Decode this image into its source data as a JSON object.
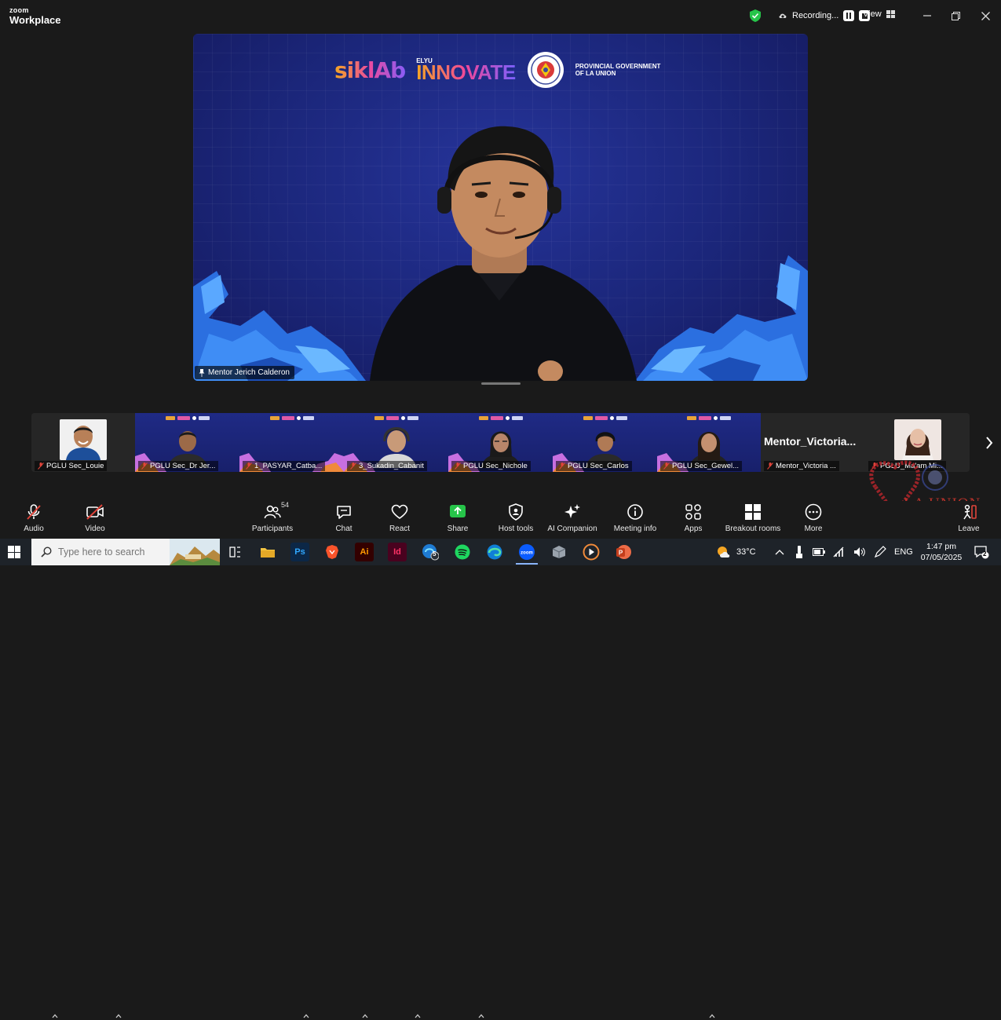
{
  "window": {
    "brand_top": "zoom",
    "brand_bottom": "Workplace",
    "recording_label": "Recording...",
    "view_label": "View",
    "controls": [
      "minimize",
      "restore",
      "close"
    ]
  },
  "main_video": {
    "speaker_name": "Mentor Jerich Calderon",
    "background_logos": {
      "siklab": "siklAb",
      "elyu_top": "ELYU",
      "elyu_main": "INNOVATE",
      "gov_line1": "PROVINCIAL GOVERNMENT",
      "gov_line2": "OF LA UNION"
    }
  },
  "participants": [
    {
      "label": "PGLU Sec_Louie",
      "kind": "photo"
    },
    {
      "label": "PGLU Sec_Dr Jer...",
      "kind": "video"
    },
    {
      "label": "1_PASYAR_Catba...",
      "kind": "video"
    },
    {
      "label": "3_Sukadin_Cabanit",
      "kind": "video"
    },
    {
      "label": "PGLU Sec_Nichole",
      "kind": "video"
    },
    {
      "label": "PGLU Sec_Carlos",
      "kind": "video"
    },
    {
      "label": "PGLU Sec_Gewel...",
      "kind": "video"
    },
    {
      "label": "Mentor_Victoria ...",
      "kind": "name",
      "big_name": "Mentor_Victoria..."
    },
    {
      "label": "PGLU_Ma'am Mi...",
      "kind": "photo"
    }
  ],
  "toolbar": {
    "audio": "Audio",
    "video": "Video",
    "participants": "Participants",
    "participants_count": "54",
    "chat": "Chat",
    "react": "React",
    "share": "Share",
    "host_tools": "Host tools",
    "ai_companion": "AI Companion",
    "meeting_info": "Meeting info",
    "apps": "Apps",
    "breakout_rooms": "Breakout rooms",
    "more": "More",
    "leave": "Leave"
  },
  "watermark": {
    "text": "LA UNION"
  },
  "taskbar": {
    "search_placeholder": "Type here to search",
    "apps": [
      "task-view",
      "file-explorer",
      "photoshop",
      "brave",
      "illustrator",
      "indesign",
      "edge-badge",
      "spotify",
      "edge",
      "zoom",
      "app-box",
      "media-player",
      "powerpoint"
    ],
    "ps": "Ps",
    "ai": "Ai",
    "id": "Id",
    "badge_count": "5",
    "temperature": "33°C",
    "language": "ENG",
    "time": "1:47 pm",
    "date": "07/05/2025",
    "notification_count": "2"
  },
  "colors": {
    "accent_green": "#26c449",
    "mute_red": "#e0443a",
    "zoom_blue": "#0b5cff",
    "watermark_red": "#c9352c"
  }
}
